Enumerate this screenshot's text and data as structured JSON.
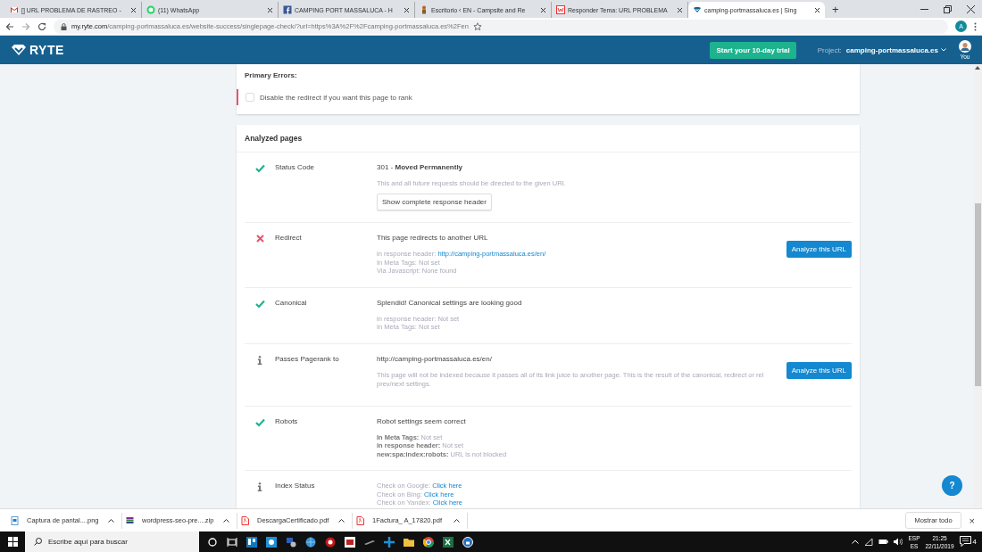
{
  "browser": {
    "tabs": [
      {
        "title": "[] URL PROBLEMA DE RASTREO -",
        "selected": false
      },
      {
        "title": "(11) WhatsApp",
        "selected": false
      },
      {
        "title": "CAMPING PORT MASSALUCA - H",
        "selected": false
      },
      {
        "title": "Escritorio ‹ EN - Campsite and Re",
        "selected": false
      },
      {
        "title": "Responder Tema: URL PROBLEMA",
        "selected": false
      },
      {
        "title": "camping-portmassaluca.es | Sing",
        "selected": true
      }
    ],
    "new_tab": "+",
    "url": {
      "host": "my.ryte.com",
      "path": "/camping-portmassaluca.es/website-success/singlepage-check/?url=https%3A%2F%2Fcamping-portmassaluca.es%2Fen"
    },
    "profile": "A"
  },
  "header": {
    "logo": "RYTE",
    "trial_button": "Start your 10-day trial",
    "project_label": "Project:",
    "project": "camping-portmassaluca.es",
    "user": "You"
  },
  "primary_errors": {
    "title": "Primary Errors:",
    "items": [
      {
        "text": "Disable the redirect if you want this page to rank",
        "checked": false
      }
    ]
  },
  "analyzed": {
    "title": "Analyzed pages",
    "rows": [
      {
        "kind": "ok",
        "label": "Status Code",
        "headline": "301 - **Moved Permanently**",
        "description": "This and all future requests should be directed to the given URI.",
        "button": "Show complete response header"
      },
      {
        "kind": "error",
        "label": "Redirect",
        "headline": "This page redirects to another URL",
        "details": [
          {
            "text": "in response header: ",
            "link": "http://camping-portmassaluca.es/en/"
          },
          {
            "text": "In Meta Tags: Not set"
          },
          {
            "text": "Via Javascript: None found"
          }
        ],
        "action": "Analyze this URL"
      },
      {
        "kind": "ok",
        "label": "Canonical",
        "headline": "Splendid! Canonical settings are looking good",
        "details": [
          {
            "text": "in response header: Not set"
          },
          {
            "text": "In Meta Tags: Not set"
          }
        ]
      },
      {
        "kind": "info",
        "label": "Passes Pagerank to",
        "headline": "http://camping-portmassaluca.es/en/",
        "description": "This page will not be indexed because it passes all of its link juice to another page. This is the result of the canonical, redirect or rel prev/next settings.",
        "action": "Analyze this URL"
      },
      {
        "kind": "ok",
        "label": "Robots",
        "headline": "Robot settings seem correct",
        "details": [
          {
            "text": "**In Meta Tags:** Not set"
          },
          {
            "text": "**in response header:** Not set"
          },
          {
            "text": "**new:spa:index:robots:** URL is not blocked"
          }
        ]
      },
      {
        "kind": "info",
        "label": "Index Status",
        "details": [
          {
            "text": "Check on Google: ",
            "link": "Click here"
          },
          {
            "text": "Check on Bing: ",
            "link": "Click here"
          },
          {
            "text": "Check on Yandex: ",
            "link": "Click here"
          }
        ]
      }
    ]
  },
  "help_button": "?",
  "downloads": {
    "items": [
      {
        "name": "Captura de pantal....png"
      },
      {
        "name": "wordpress-seo-pre....zip"
      },
      {
        "name": "DescargaCertificado.pdf"
      },
      {
        "name": "1Factura_ A_17820.pdf"
      }
    ],
    "show_all": "Mostrar todo",
    "close": "×"
  },
  "taskbar": {
    "search_placeholder": "Escribe aquí para buscar",
    "language": "ESP",
    "layout": "ES",
    "time": "21:25",
    "date": "22/11/2019",
    "notifications": "4"
  }
}
